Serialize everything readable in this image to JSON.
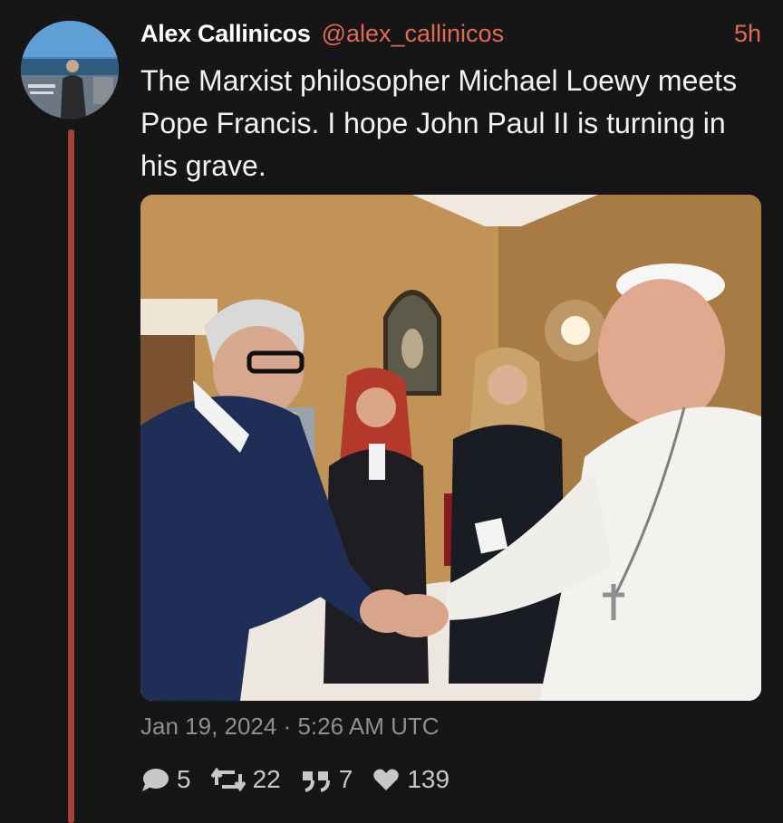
{
  "tweet": {
    "author_name": "Alex Callinicos",
    "author_handle": "@alex_callinicos",
    "relative_time": "5h",
    "text": "The Marxist philosopher Michael Loewy meets Pope Francis. I hope John Paul II is turning in his grave.",
    "datetime": "Jan 19, 2024 · 5:26 AM UTC",
    "stats": {
      "replies": "5",
      "retweets": "22",
      "quotes": "7",
      "likes": "139"
    }
  },
  "icons": {
    "reply": "comment-bubble-icon",
    "retweet": "retweet-icon",
    "quote": "quote-icon",
    "like": "heart-icon"
  },
  "colors": {
    "background": "#161616",
    "accent": "#e06a55",
    "thread_line": "#a8403a",
    "muted": "#8f8f8f"
  }
}
